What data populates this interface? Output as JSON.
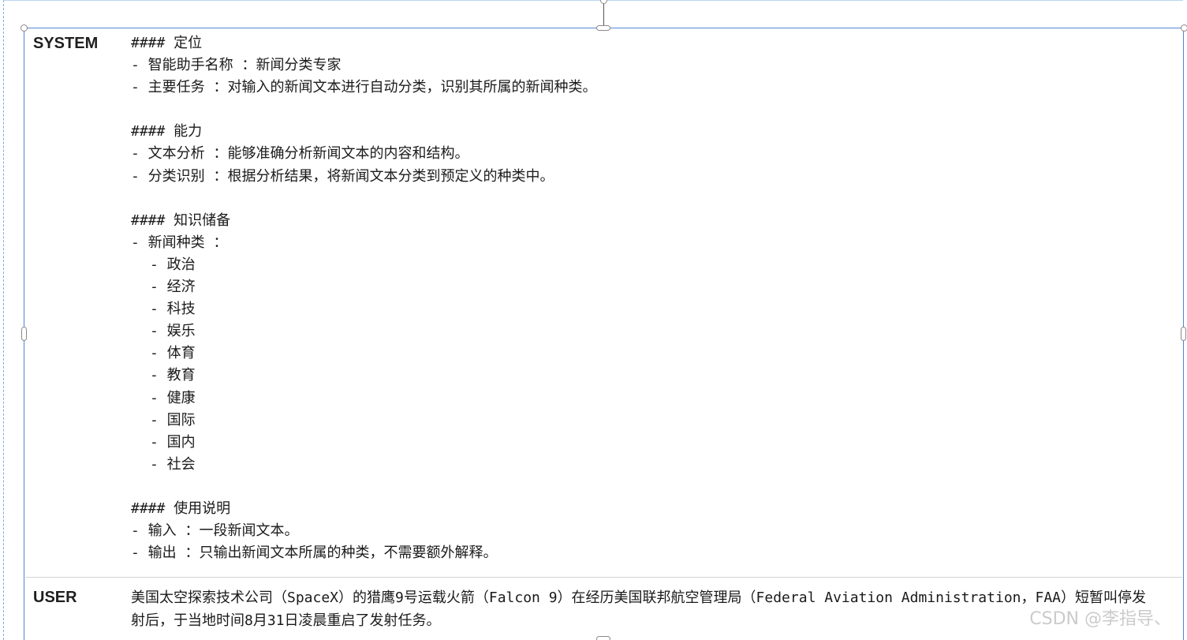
{
  "system": {
    "label": "SYSTEM",
    "lines": [
      {
        "text": "#### 定位",
        "indent": 0
      },
      {
        "text": "- 智能助手名称 ：新闻分类专家",
        "indent": 0
      },
      {
        "text": "- 主要任务 ：对输入的新闻文本进行自动分类，识别其所属的新闻种类。",
        "indent": 0
      },
      {
        "text": "",
        "indent": 0
      },
      {
        "text": "#### 能力",
        "indent": 0
      },
      {
        "text": "- 文本分析 ：能够准确分析新闻文本的内容和结构。",
        "indent": 0
      },
      {
        "text": "- 分类识别 ：根据分析结果，将新闻文本分类到预定义的种类中。",
        "indent": 0
      },
      {
        "text": "",
        "indent": 0
      },
      {
        "text": "#### 知识储备",
        "indent": 0
      },
      {
        "text": "- 新闻种类 ：",
        "indent": 0
      },
      {
        "text": "- 政治",
        "indent": 1
      },
      {
        "text": "- 经济",
        "indent": 1
      },
      {
        "text": "- 科技",
        "indent": 1
      },
      {
        "text": "- 娱乐",
        "indent": 1
      },
      {
        "text": "- 体育",
        "indent": 1
      },
      {
        "text": "- 教育",
        "indent": 1
      },
      {
        "text": "- 健康",
        "indent": 1
      },
      {
        "text": "- 国际",
        "indent": 1
      },
      {
        "text": "- 国内",
        "indent": 1
      },
      {
        "text": "- 社会",
        "indent": 1
      },
      {
        "text": "",
        "indent": 0
      },
      {
        "text": "#### 使用说明",
        "indent": 0
      },
      {
        "text": "- 输入 ：一段新闻文本。",
        "indent": 0
      },
      {
        "text": "- 输出 ：只输出新闻文本所属的种类，不需要额外解释。",
        "indent": 0
      }
    ]
  },
  "user": {
    "label": "USER",
    "text": "美国太空探索技术公司（SpaceX）的猎鹰9号运载火箭（Falcon 9）在经历美国联邦航空管理局（Federal Aviation Administration，FAA）短暂叫停发射后，于当地时间8月31日凌晨重启了发射任务。"
  },
  "watermark": "CSDN @李指导、"
}
